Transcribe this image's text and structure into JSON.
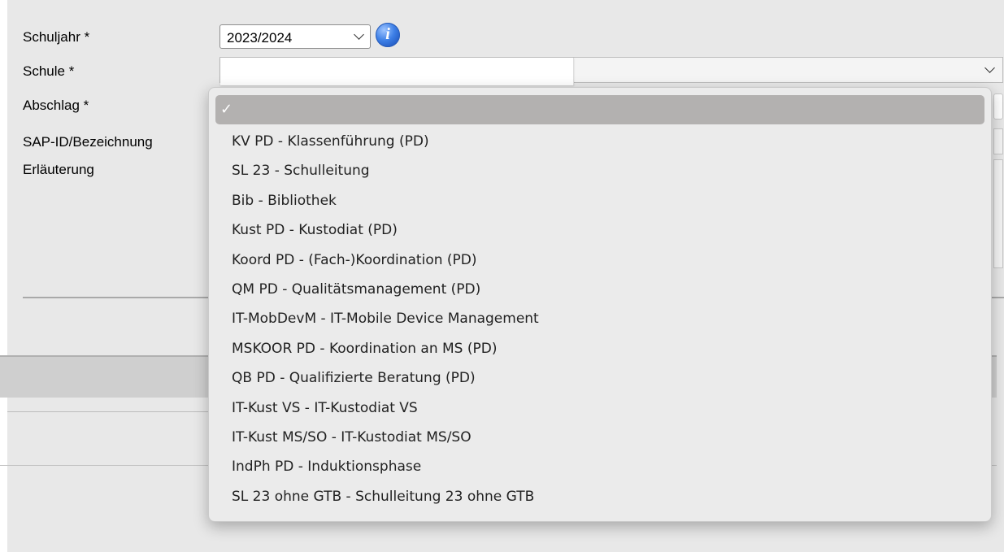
{
  "form": {
    "labels": {
      "schuljahr": "Schuljahr *",
      "schule": "Schule *",
      "abschlag": "Abschlag *",
      "sap": "SAP-ID/Bezeichnung",
      "erlaeuterung": "Erläuterung"
    },
    "schuljahr_value": "2023/2024",
    "schule_value": ""
  },
  "icons": {
    "info": "info-icon",
    "info_glyph": "i",
    "checkmark": "checkmark-icon",
    "chevron": "chevron-down-icon"
  },
  "dropdown": {
    "selected_label": "",
    "check_glyph": "✓",
    "items": [
      "KV PD - Klassenführung (PD)",
      "SL 23 - Schulleitung",
      "Bib - Bibliothek",
      "Kust PD - Kustodiat (PD)",
      "Koord PD - (Fach-)Koordination (PD)",
      "QM PD - Qualitätsmanagement (PD)",
      "IT-MobDevM - IT-Mobile Device Management",
      "MSKOOR PD - Koordination an MS (PD)",
      "QB PD - Qualifizierte Beratung (PD)",
      "IT-Kust VS - IT-Kustodiat VS",
      "IT-Kust MS/SO - IT-Kustodiat MS/SO",
      "IndPh PD - Induktionsphase",
      "SL 23 ohne GTB - Schulleitung 23 ohne GTB"
    ]
  },
  "colors": {
    "page_bg": "#e8e8e8",
    "menu_bg": "#ebebeb",
    "menu_highlight": "#b3b1b0",
    "info_blue": "#3d7fe6"
  }
}
